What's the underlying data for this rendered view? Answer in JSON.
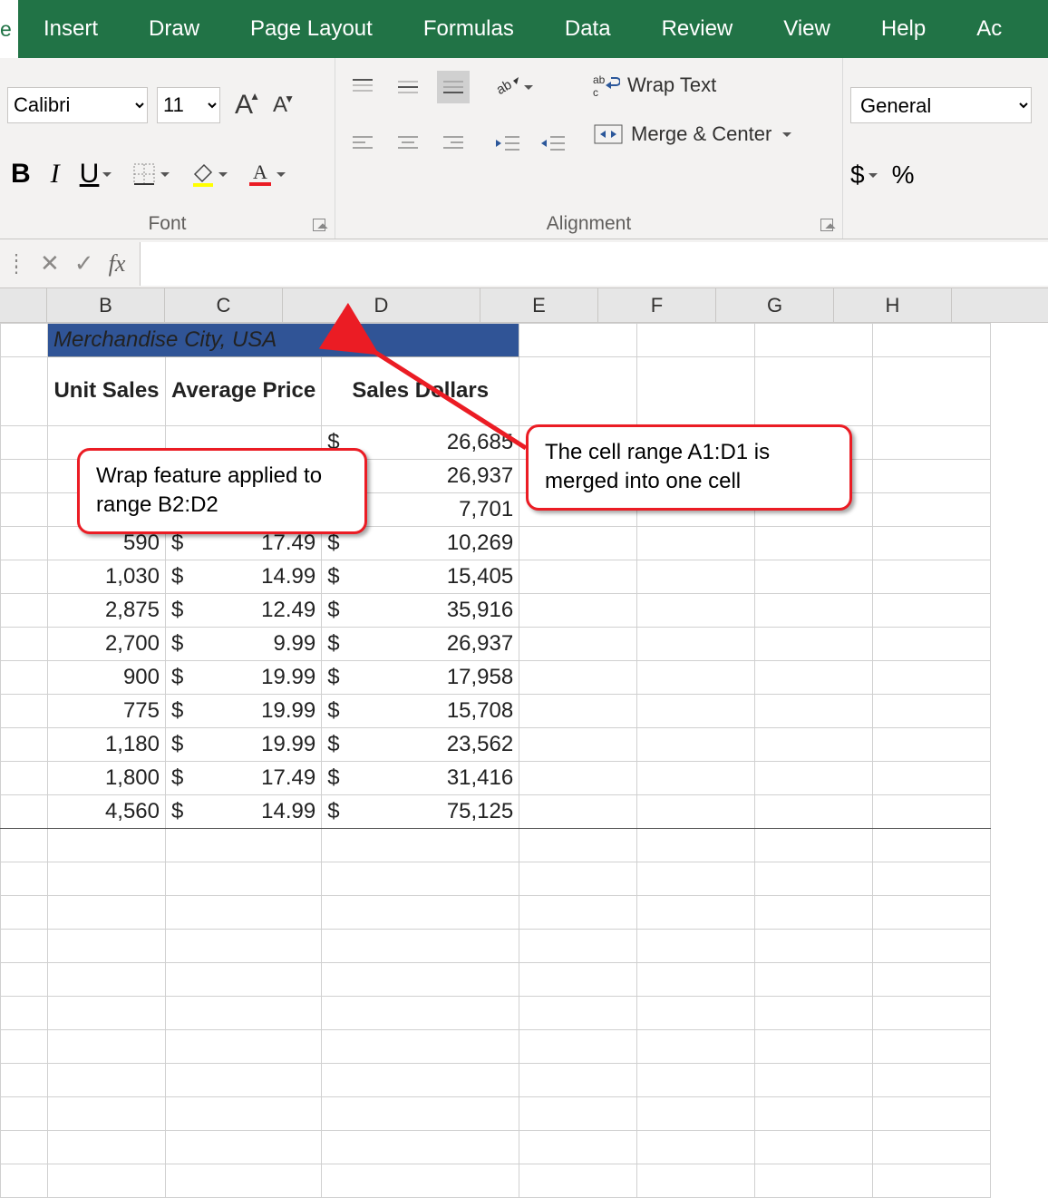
{
  "tabs": {
    "active": "e",
    "items": [
      "Insert",
      "Draw",
      "Page Layout",
      "Formulas",
      "Data",
      "Review",
      "View",
      "Help",
      "Ac"
    ]
  },
  "font": {
    "name": "Calibri",
    "size": "11",
    "grow": "A",
    "shrink": "A",
    "bold": "B",
    "italic": "I",
    "underline": "U",
    "group": "Font"
  },
  "alignment": {
    "wrap": "Wrap Text",
    "merge": "Merge & Center",
    "group": "Alignment"
  },
  "number": {
    "format": "General",
    "dollar": "$",
    "percent": "%"
  },
  "fx_label": "fx",
  "columns": [
    "B",
    "C",
    "D",
    "E",
    "F",
    "G",
    "H"
  ],
  "title": "Merchandise City, USA",
  "headers": {
    "b": "Unit Sales",
    "c": "Average Price",
    "d": "Sales Dollars"
  },
  "rows": [
    {
      "d": "26,685"
    },
    {
      "d": "26,937"
    },
    {
      "d": "7,701"
    },
    {
      "b": "590",
      "c": "17.49",
      "d": "10,269"
    },
    {
      "b": "1,030",
      "c": "14.99",
      "d": "15,405"
    },
    {
      "b": "2,875",
      "c": "12.49",
      "d": "35,916"
    },
    {
      "b": "2,700",
      "c": "9.99",
      "d": "26,937"
    },
    {
      "b": "900",
      "c": "19.99",
      "d": "17,958"
    },
    {
      "b": "775",
      "c": "19.99",
      "d": "15,708"
    },
    {
      "b": "1,180",
      "c": "19.99",
      "d": "23,562"
    },
    {
      "b": "1,800",
      "c": "17.49",
      "d": "31,416"
    },
    {
      "b": "4,560",
      "c": "14.99",
      "d": "75,125"
    }
  ],
  "cur": "$",
  "callouts": {
    "c1": "Wrap feature applied to range B2:D2",
    "c2": "The cell range A1:D1 is merged into one cell"
  }
}
